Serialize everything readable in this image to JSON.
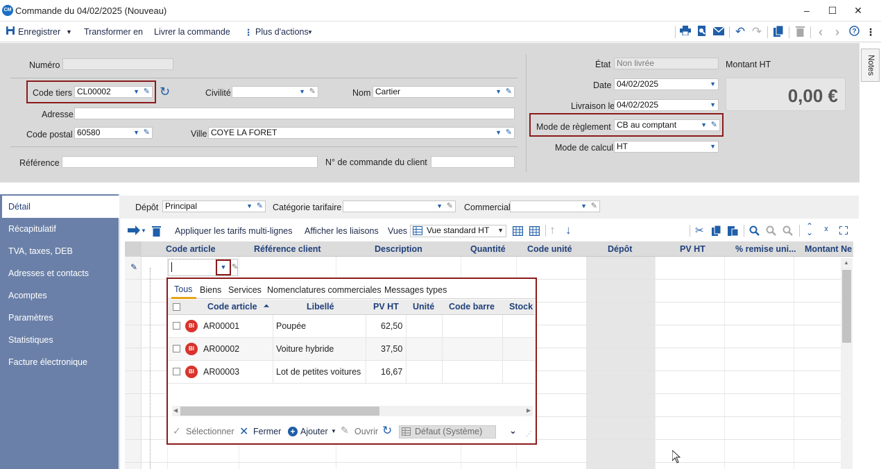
{
  "window": {
    "logo": "CM",
    "title": "Commande du 04/02/2025 (Nouveau)",
    "minimize_icon": "–",
    "maximize_icon": "☐",
    "close_icon": "✕"
  },
  "menubar": {
    "save_label": "Enregistrer",
    "transform_label": "Transformer en",
    "deliver_label": "Livrer la commande",
    "more_label": "Plus d'actions"
  },
  "header": {
    "numero_label": "Numéro",
    "numero_value": "",
    "code_tiers_label": "Code tiers",
    "code_tiers_value": "CL00002",
    "civilite_label": "Civilité",
    "civilite_value": "",
    "nom_label": "Nom",
    "nom_value": "Cartier",
    "adresse_label": "Adresse",
    "adresse_value": "",
    "cp_label": "Code postal",
    "cp_value": "60580",
    "ville_label": "Ville",
    "ville_value": "COYE LA FORET",
    "reference_label": "Référence",
    "reference_value": "",
    "num_cmd_label": "N° de commande du client",
    "num_cmd_value": "",
    "etat_label": "État",
    "etat_value": "Non livrée",
    "date_label": "Date",
    "date_value": "04/02/2025",
    "livraison_label": "Livraison le",
    "livraison_value": "04/02/2025",
    "reglement_label": "Mode de règlement",
    "reglement_value": "CB au comptant",
    "calcul_label": "Mode de calcul",
    "calcul_value": "HT",
    "montant_label": "Montant HT",
    "montant_value": "0,00 €",
    "notes_label": "Notes"
  },
  "sidebar": {
    "items": [
      {
        "label": "Détail"
      },
      {
        "label": "Récapitulatif"
      },
      {
        "label": "TVA, taxes, DEB"
      },
      {
        "label": "Adresses et contacts"
      },
      {
        "label": "Acomptes"
      },
      {
        "label": "Paramètres"
      },
      {
        "label": "Statistiques"
      },
      {
        "label": "Facture électronique"
      }
    ]
  },
  "detail": {
    "depot_label": "Dépôt",
    "depot_value": "Principal",
    "categorie_label": "Catégorie tarifaire",
    "categorie_value": "",
    "commercial_label": "Commercial",
    "commercial_value": "",
    "apply_tarifs_label": "Appliquer les tarifs multi-lignes",
    "show_links_label": "Afficher les liaisons",
    "vues_label": "Vues",
    "vue_value": "Vue standard HT"
  },
  "grid": {
    "columns": [
      "Code article",
      "Référence client",
      "Description",
      "Quantité",
      "Code unité",
      "Dépôt",
      "PV HT",
      "% remise uni...",
      "Montant Ne"
    ]
  },
  "popup": {
    "tabs": [
      "Tous",
      "Biens",
      "Services",
      "Nomenclatures commerciales",
      "Messages types"
    ],
    "columns": [
      "Code article",
      "Libellé",
      "PV HT",
      "Unité",
      "Code barre",
      "Stock"
    ],
    "sort_icon": "⏶",
    "rows": [
      {
        "badge": "BI",
        "code": "AR00001",
        "libelle": "Poupée",
        "pv": "62,50"
      },
      {
        "badge": "BI",
        "code": "AR00002",
        "libelle": "Voiture hybride",
        "pv": "37,50"
      },
      {
        "badge": "BI",
        "code": "AR00003",
        "libelle": "Lot de petites voitures",
        "pv": "16,67"
      }
    ],
    "footer": {
      "select_label": "Sélectionner",
      "close_label": "Fermer",
      "add_label": "Ajouter",
      "open_label": "Ouvrir",
      "view_value": "Défaut (Système)"
    }
  },
  "colors": {
    "highlight": "#8b1a1a",
    "sidebar": "#6b80a8",
    "accent": "#1f5ea8",
    "badge": "#d9332b"
  }
}
